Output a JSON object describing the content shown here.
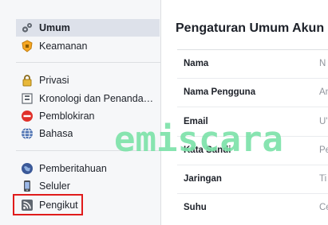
{
  "sidebar": {
    "groups": [
      [
        {
          "label": "Umum",
          "icon": "gears-icon"
        },
        {
          "label": "Keamanan",
          "icon": "shield-badge-icon"
        }
      ],
      [
        {
          "label": "Privasi",
          "icon": "padlock-icon"
        },
        {
          "label": "Kronologi dan Penanda…",
          "icon": "timeline-icon"
        },
        {
          "label": "Pemblokiran",
          "icon": "block-icon"
        },
        {
          "label": "Bahasa",
          "icon": "globe-icon"
        }
      ],
      [
        {
          "label": "Pemberitahuan",
          "icon": "globe-notification-icon"
        },
        {
          "label": "Seluler",
          "icon": "mobile-phone-icon"
        },
        {
          "label": "Pengikut",
          "icon": "rss-icon"
        }
      ]
    ],
    "selected": "Umum"
  },
  "main": {
    "title": "Pengaturan Umum Akun",
    "rows": [
      {
        "label": "Nama",
        "value": "N"
      },
      {
        "label": "Nama Pengguna",
        "value": "An"
      },
      {
        "label": "Email",
        "value": "U'"
      },
      {
        "label": "Kata Sandi",
        "value": "Pe"
      },
      {
        "label": "Jaringan",
        "value": "Ti"
      },
      {
        "label": "Suhu",
        "value": "Ce"
      }
    ]
  },
  "watermark": "emiscara",
  "colors": {
    "highlight": "#e01b1b",
    "selected_bg": "#dde1ea",
    "watermark": "#7be2a8"
  }
}
